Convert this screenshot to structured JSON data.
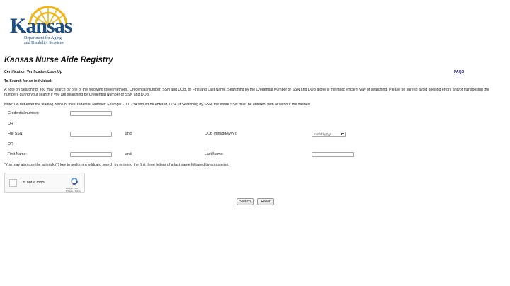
{
  "brand": {
    "name": "Kansas",
    "department_line1": "Department for Aging",
    "department_line2": "and Disability Services",
    "colors": {
      "navy": "#1e4f82",
      "gold": "#f2b417"
    }
  },
  "page": {
    "title": "Kansas Nurse Aide Registry",
    "subtitle": "Certification Verification Look Up",
    "faqs_link": "FAQS",
    "search_heading": "To Search for an individual:",
    "note_searching": "A note on Searching: You may search by one of the following three methods, Credential Number, SSN and DOB, or First and Last Name. Searching by the Credential Number or SSN and DOB alone is the most efficient way of searching. Please be sure to avoid spelling errors and/or transposing the numbers during your search if you are searching by Credential Number or SSN and DOB.",
    "note_leading_zeros": "Note: Do not enter the leading zeros of the Credential Number. Example - 001234 should be entered 1234. If Searching by SSN, the entire SSN must be entered, with or without the dashes."
  },
  "form": {
    "credential_label": "Credential number:",
    "credential_value": "",
    "or1": "OR",
    "ssn_label": "Full SSN",
    "ssn_value": "",
    "and1": "and",
    "dob_label": "DOB (mm/dd/yyyy):",
    "dob_placeholder": "mm/dd/yyyy",
    "or2": "OR",
    "first_name_label": "First Name:",
    "first_name_value": "",
    "and2": "and",
    "last_name_label": "Last Name:",
    "last_name_value": "",
    "wildcard_note": "*You may also use the asterisk (*) key to perform a wildcard search by entering the first three letters of a last name followed by an asterisk."
  },
  "captcha": {
    "label": "I'm not a robot",
    "brand": "reCAPTCHA",
    "terms": "Privacy - Terms",
    "icon": "recaptcha-icon"
  },
  "buttons": {
    "search": "Search",
    "reset": "Reset"
  }
}
